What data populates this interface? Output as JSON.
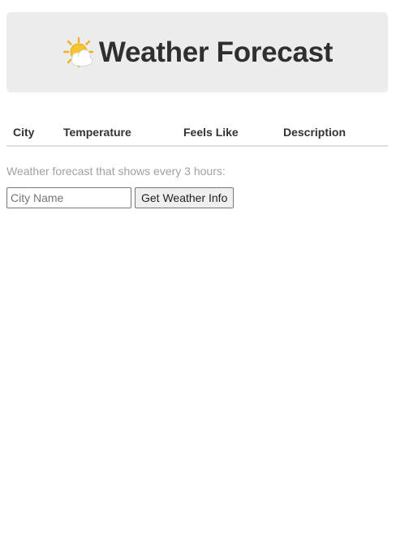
{
  "header": {
    "icon": "sun-behind-cloud-icon",
    "title": "Weather Forecast"
  },
  "table": {
    "columns": [
      "City",
      "Temperature",
      "Feels Like",
      "Description"
    ],
    "rows": []
  },
  "note": "Weather forecast that shows every 3 hours:",
  "form": {
    "city_placeholder": "City Name",
    "submit_label": "Get Weather Info"
  },
  "colors": {
    "header_bg": "#ececec",
    "muted_text": "#a0a0a0",
    "divider": "#dddddd"
  }
}
